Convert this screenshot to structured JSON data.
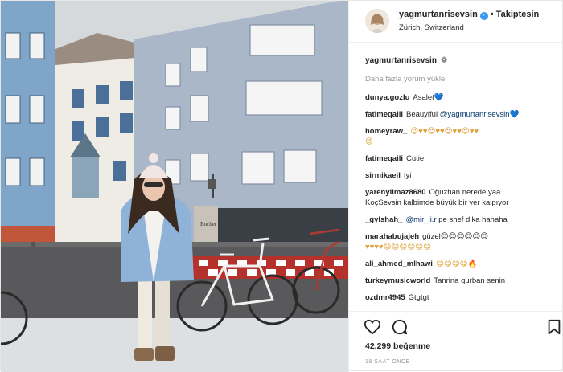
{
  "post": {
    "username": "yagmurtanrisevsin",
    "follow_label": "Takiptesin",
    "location": "Zürich, Switzerland",
    "caption_user": "yagmurtanrisevsin",
    "caption_emoji": "❁",
    "load_more": "Daha fazla yorum yükle",
    "likes": "42.299 beğenme",
    "time": "18 SAAT ÖNCE"
  },
  "photo": {
    "shop_sign": "Bucher"
  },
  "comments": [
    {
      "user": "dunya.gozlu",
      "text": "Asalet",
      "suffix": "💙"
    },
    {
      "user": "fatimeqaili",
      "text": "Beauyiful",
      "mention": "@yagmurtanrisevsin",
      "suffix": "💙"
    },
    {
      "user": "homeyraw_",
      "text": "",
      "suffix": "😍♥♥😍♥♥😍♥♥😍♥♥",
      "line2": "😍"
    },
    {
      "user": "fatimeqaili",
      "text": "Cutie"
    },
    {
      "user": "sirmikaeil",
      "text": "Iyi"
    },
    {
      "user": "yarenyilmaz8680",
      "text": "Oğuzhan nerede yaa",
      "line2": "KoçSevsin kalbimde büyük bir yer kalpıyor"
    },
    {
      "user": "_gylshah_",
      "mention": "@mir_ii.r",
      "text": "pe shef dika hahaha"
    },
    {
      "user": "marahabujajeh",
      "text": "güzel😍😍😍😍😍😍",
      "line2": "♥♥♥♥😋😋😋😋😋😋"
    },
    {
      "user": "ali_ahmed_mlhawi",
      "text": "",
      "suffix": "😋😋😋😋🔥"
    },
    {
      "user": "turkeymusicworld",
      "text": "Tanrina gurban senin"
    },
    {
      "user": "ozdmr4945",
      "text": "Gtgtgt"
    }
  ],
  "colors": {
    "link": "#003569",
    "muted": "#999999",
    "verified": "#3897f0"
  },
  "icons": [
    "heart-icon",
    "comment-icon",
    "bookmark-icon",
    "verified-icon"
  ]
}
